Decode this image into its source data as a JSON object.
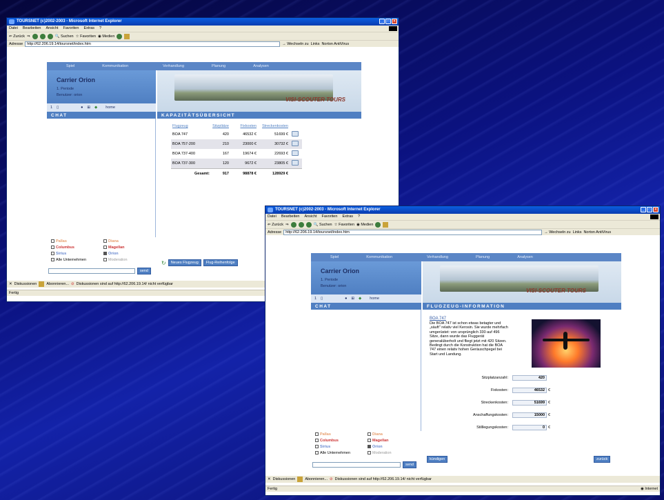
{
  "browser": {
    "title": "TOURSNET (c)2002-2003 - Microsoft Internet Explorer",
    "menu": [
      "Datei",
      "Bearbeiten",
      "Ansicht",
      "Favoriten",
      "Extras",
      "?"
    ],
    "toolbar": {
      "back": "Zurück",
      "search": "Suchen",
      "favorites": "Favoriten",
      "media": "Medien"
    },
    "address_label": "Adresse",
    "address": "http://62.206.19.14/toursnet/index.htm",
    "go_label": "Wechseln zu",
    "links_label": "Links",
    "norton_label": "Norton AntiVirus",
    "discussions_label": "Diskussionen",
    "subscribe_label": "Abonnieren...",
    "discussion_msg": "Diskussionen sind auf http://62.206.19.14/ nicht verfügbar",
    "status_done": "Fertig",
    "status_zone": "Internet"
  },
  "app": {
    "nav": [
      "Spiel",
      "Kommunikation",
      "Verhandlung",
      "Planung",
      "Analysen"
    ],
    "carrier": "Carrier Orion",
    "period": "1. Periode",
    "user": "Benutzer: orion",
    "status": {
      "count": "1",
      "home": "home"
    },
    "chat_header": "CHAT",
    "banner_logo": "VISI-SCOUTER  TOURS",
    "players": [
      {
        "label": "Pallas",
        "color": "#e8a070",
        "checked": false
      },
      {
        "label": "Diana",
        "color": "#e8a070",
        "checked": false
      },
      {
        "label": "Columbus",
        "color": "#cc3333",
        "checked": false
      },
      {
        "label": "Magellan",
        "color": "#cc3333",
        "checked": false
      },
      {
        "label": "Sirius",
        "color": "#6a8ad0",
        "checked": false
      },
      {
        "label": "Orion",
        "color": "#6a8ad0",
        "checked": true
      },
      {
        "label": "Alle Unternehmen",
        "color": "#000000",
        "checked": false
      },
      {
        "label": "Moderation",
        "color": "#999999",
        "checked": false
      }
    ],
    "send_label": "send"
  },
  "window1": {
    "section_header": "KAPAZITÄTSÜBERSICHT",
    "table": {
      "headers": [
        "Flugzeug",
        "Sitzplätze",
        "Fixkosten",
        "Streckenkosten"
      ],
      "rows": [
        [
          "BOA 747",
          "420",
          "46532 €",
          "51699 €"
        ],
        [
          "BOA 757-200",
          "210",
          "23000 €",
          "30732 €"
        ],
        [
          "BOA 737-400",
          "167",
          "19674 €",
          "22693 €"
        ],
        [
          "BOA 737-300",
          "120",
          "9672 €",
          "23805 €"
        ]
      ],
      "total_label": "Gesamt:",
      "total": [
        "917",
        "98878 €",
        "128929 €"
      ]
    },
    "btn_new": "Neues Flugzeug",
    "btn_order": "Flug-Reihenfolge"
  },
  "window2": {
    "section_header": "FLUGZEUG-INFORMATION",
    "aircraft": "BOA 747",
    "description": "Die BOA 747 ist schon etwas betagter und „säuft\" relativ viel Kerosin. Sie wurde mehrfach umgerüstet: von ursprünglich 330 auf 496 Sitze, dann wurde das Fluggerät generalüberholt und fliegt jetzt mit 420 Sitzen. Bedingt durch die Konstruktion hat die BOA 747 einen relativ hohen Geräuschpegel bei Start und Landung.",
    "fields": [
      {
        "label": "Sitzplatzanzahl:",
        "value": "420",
        "unit": ""
      },
      {
        "label": "Fixkosten:",
        "value": "46532",
        "unit": "€"
      },
      {
        "label": "Streckenkosten:",
        "value": "51699",
        "unit": "€"
      },
      {
        "label": "Anschaffungskosten:",
        "value": "15000",
        "unit": "€"
      },
      {
        "label": "Stilllegungskosten:",
        "value": "0",
        "unit": "€"
      }
    ],
    "btn_cancel": "kündigen",
    "btn_back": "zurück"
  }
}
